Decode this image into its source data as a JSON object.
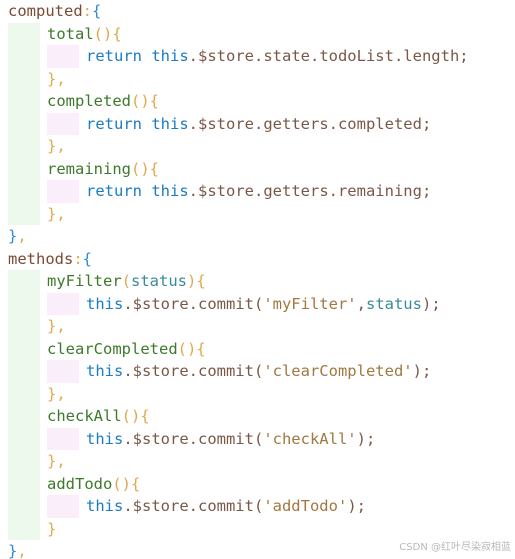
{
  "lines": [
    {
      "indent": 0,
      "tokens": [
        [
          "key",
          "computed"
        ],
        [
          "punc",
          ":"
        ],
        [
          "brace",
          "{"
        ]
      ]
    },
    {
      "indent": 1,
      "tokens": [
        [
          "fn",
          "total"
        ],
        [
          "punc",
          "(){"
        ]
      ]
    },
    {
      "indent": 2,
      "tokens": [
        [
          "kw",
          "return"
        ],
        [
          "prop",
          " "
        ],
        [
          "kw",
          "this"
        ],
        [
          "prop",
          ".$store.state.todoList.length;"
        ]
      ]
    },
    {
      "indent": 1,
      "tokens": [
        [
          "punc",
          "},"
        ]
      ]
    },
    {
      "indent": 1,
      "tokens": [
        [
          "fn",
          "completed"
        ],
        [
          "punc",
          "(){"
        ]
      ]
    },
    {
      "indent": 2,
      "tokens": [
        [
          "kw",
          "return"
        ],
        [
          "prop",
          " "
        ],
        [
          "kw",
          "this"
        ],
        [
          "prop",
          ".$store.getters.completed;"
        ]
      ]
    },
    {
      "indent": 1,
      "tokens": [
        [
          "punc",
          "},"
        ]
      ]
    },
    {
      "indent": 1,
      "tokens": [
        [
          "fn",
          "remaining"
        ],
        [
          "punc",
          "(){"
        ]
      ]
    },
    {
      "indent": 2,
      "tokens": [
        [
          "kw",
          "return"
        ],
        [
          "prop",
          " "
        ],
        [
          "kw",
          "this"
        ],
        [
          "prop",
          ".$store.getters.remaining;"
        ]
      ]
    },
    {
      "indent": 1,
      "tokens": [
        [
          "punc",
          "},"
        ]
      ]
    },
    {
      "indent": 0,
      "tokens": [
        [
          "brace",
          "}"
        ],
        [
          "punc",
          ","
        ]
      ]
    },
    {
      "indent": 0,
      "tokens": [
        [
          "key",
          "methods"
        ],
        [
          "punc",
          ":"
        ],
        [
          "brace",
          "{"
        ]
      ]
    },
    {
      "indent": 1,
      "tokens": [
        [
          "fn",
          "myFilter"
        ],
        [
          "punc",
          "("
        ],
        [
          "param",
          "status"
        ],
        [
          "punc",
          "){"
        ]
      ]
    },
    {
      "indent": 2,
      "tokens": [
        [
          "kw",
          "this"
        ],
        [
          "prop",
          ".$store.commit("
        ],
        [
          "str",
          "'myFilter'"
        ],
        [
          "prop",
          ","
        ],
        [
          "param",
          "status"
        ],
        [
          "prop",
          ");"
        ]
      ]
    },
    {
      "indent": 1,
      "tokens": [
        [
          "punc",
          "},"
        ]
      ]
    },
    {
      "indent": 1,
      "tokens": [
        [
          "fn",
          "clearCompleted"
        ],
        [
          "punc",
          "(){"
        ]
      ]
    },
    {
      "indent": 2,
      "tokens": [
        [
          "kw",
          "this"
        ],
        [
          "prop",
          ".$store.commit("
        ],
        [
          "str",
          "'clearCompleted'"
        ],
        [
          "prop",
          ");"
        ]
      ]
    },
    {
      "indent": 1,
      "tokens": [
        [
          "punc",
          "},"
        ]
      ]
    },
    {
      "indent": 1,
      "tokens": [
        [
          "fn",
          "checkAll"
        ],
        [
          "punc",
          "(){"
        ]
      ]
    },
    {
      "indent": 2,
      "tokens": [
        [
          "kw",
          "this"
        ],
        [
          "prop",
          ".$store.commit("
        ],
        [
          "str",
          "'checkAll'"
        ],
        [
          "prop",
          ");"
        ]
      ]
    },
    {
      "indent": 1,
      "tokens": [
        [
          "punc",
          "},"
        ]
      ]
    },
    {
      "indent": 1,
      "tokens": [
        [
          "fn",
          "addTodo"
        ],
        [
          "punc",
          "(){"
        ]
      ]
    },
    {
      "indent": 2,
      "tokens": [
        [
          "kw",
          "this"
        ],
        [
          "prop",
          ".$store.commit("
        ],
        [
          "str",
          "'addTodo'"
        ],
        [
          "prop",
          ");"
        ]
      ]
    },
    {
      "indent": 1,
      "tokens": [
        [
          "punc",
          "}"
        ]
      ]
    },
    {
      "indent": 0,
      "tokens": [
        [
          "brace",
          "}"
        ],
        [
          "punc",
          ","
        ]
      ]
    }
  ],
  "watermark": "CSDN @红叶尽染寂相蓝",
  "colors": {
    "key": "#7a4a35",
    "fn": "#3c7a2a",
    "punc": "#e1a84e",
    "brace": "#2c8ad6",
    "kw": "#1a7cc4",
    "prop": "#7a5848",
    "str": "#a07840",
    "param": "#3a8a9a",
    "guide_level1": "#eef9ee",
    "guide_level2": "#fbeefb"
  }
}
